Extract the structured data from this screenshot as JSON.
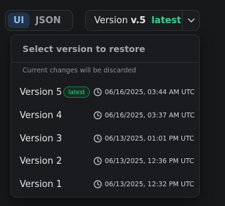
{
  "toolbar": {
    "tabs": [
      {
        "label": "UI",
        "active": true
      },
      {
        "label": "JSON",
        "active": false
      }
    ],
    "version_button": {
      "prefix": "Version ",
      "version": "v.5",
      "tag": "latest"
    },
    "chevron_icon": "chevron-down-icon"
  },
  "dropdown": {
    "title": "Select version to restore",
    "note": "Current changes will be discarded",
    "items": [
      {
        "label": "Version 5",
        "badge": "latest",
        "timestamp": "06/16/2025, 03:44 AM UTC"
      },
      {
        "label": "Version 4",
        "badge": "",
        "timestamp": "06/16/2025, 03:37 AM UTC"
      },
      {
        "label": "Version 3",
        "badge": "",
        "timestamp": "06/13/2025, 01:01 PM UTC"
      },
      {
        "label": "Version 2",
        "badge": "",
        "timestamp": "06/13/2025, 12:36 PM UTC"
      },
      {
        "label": "Version 1",
        "badge": "",
        "timestamp": "06/13/2025, 12:32 PM UTC"
      }
    ]
  },
  "colors": {
    "accent_green": "#3ecf8e",
    "active_tab": "#8db8ea",
    "background": "#17181a"
  }
}
